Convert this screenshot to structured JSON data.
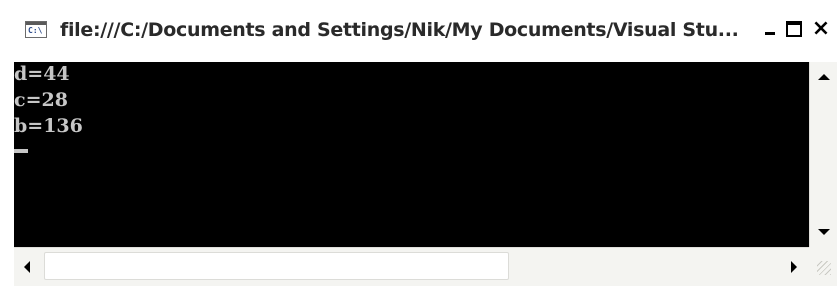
{
  "window": {
    "title": "file:///C:/Documents and Settings/Nik/My Documents/Visual Stu...",
    "icon": "console-icon",
    "icon_text": "C:\\"
  },
  "controls": {
    "minimize": "minimize-icon",
    "maximize": "maximize-icon",
    "close": "×"
  },
  "console": {
    "lines": [
      "d=44",
      "c=28",
      "b=136"
    ],
    "background": "#000000",
    "text_color": "#c6c6c6"
  }
}
